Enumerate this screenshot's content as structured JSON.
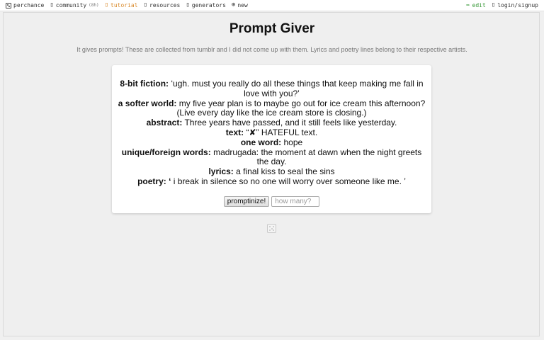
{
  "topbar": {
    "left": [
      {
        "label": "perchance",
        "icon": "dice-icon"
      },
      {
        "label": "community",
        "count": "(8h)",
        "icon": "chat-icon"
      },
      {
        "label": "tutorial",
        "icon": "book-icon"
      },
      {
        "label": "resources",
        "icon": "folder-icon"
      },
      {
        "label": "generators",
        "icon": "list-icon"
      },
      {
        "label": "new",
        "icon": "plus-circle-icon"
      }
    ],
    "right": [
      {
        "label": "edit",
        "icon": "pencil-icon"
      },
      {
        "label": "login/signup",
        "icon": "user-icon"
      }
    ]
  },
  "page": {
    "title": "Prompt Giver",
    "description": "It gives prompts! These are collected from tumblr and I did not come up with them. Lyrics and poetry lines belong to their respective artists."
  },
  "prompts": [
    {
      "category": "8-bit fiction:",
      "text": "‘ugh. must you really do all these things that keep making me fall in love with you?’"
    },
    {
      "category": "a softer world:",
      "text": "my five year plan is to maybe go out for ice cream this afternoon? (Live every day like the ice cream store is closing.)"
    },
    {
      "category": "abstract:",
      "text": "Three years have passed, and it still feels like yesterday."
    },
    {
      "category": "text:",
      "text": "“✘” HATEFUL text."
    },
    {
      "category": "one word:",
      "text": "hope"
    },
    {
      "category": "unique/foreign words:",
      "text": "madrugada: the moment at dawn when the night greets the day."
    },
    {
      "category": "lyrics:",
      "text": "a final kiss to seal the sins"
    },
    {
      "category": "poetry: ‘",
      "text": "i break in silence so no one will worry over someone like me. ’"
    }
  ],
  "controls": {
    "button_label": "promptinize!",
    "input_placeholder": "how many?",
    "input_value": ""
  },
  "colors": {
    "tutorial": "#d98a2b",
    "edit": "#3a9a3a",
    "background": "#f0f0f0"
  }
}
